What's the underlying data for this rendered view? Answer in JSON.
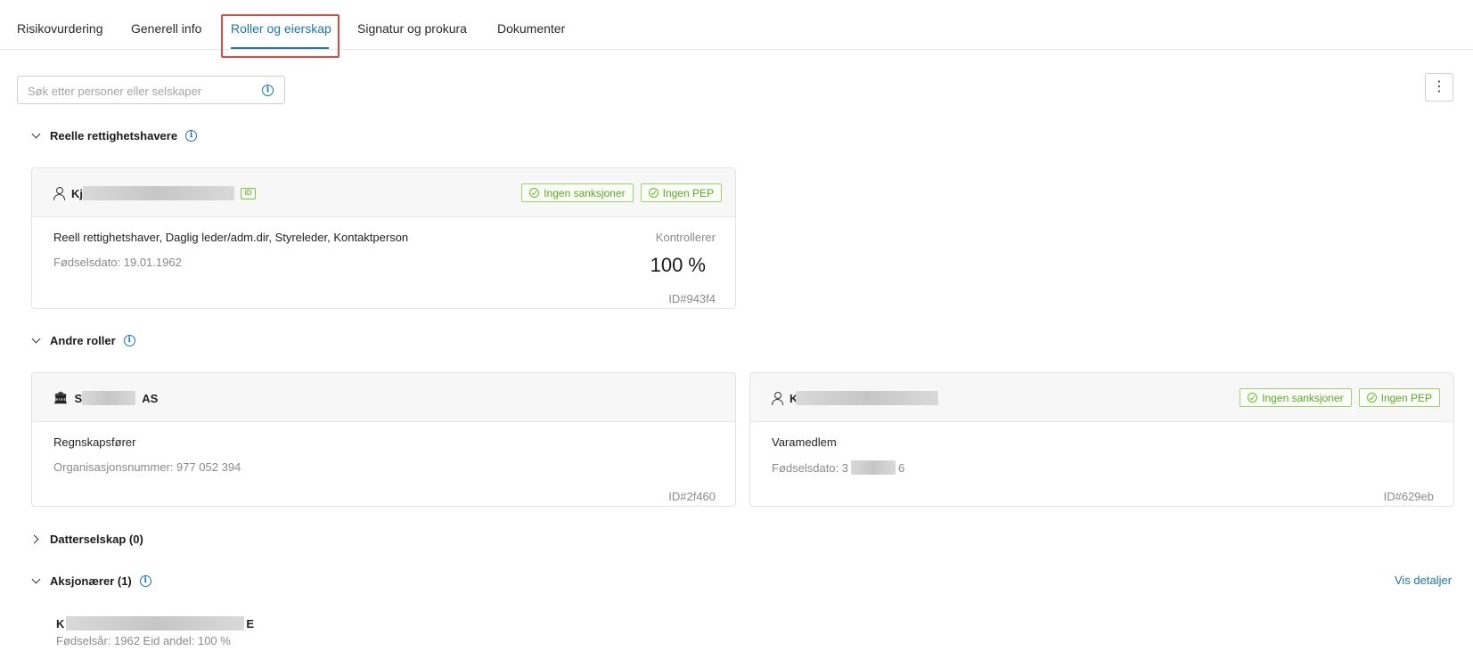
{
  "tabs": [
    {
      "label": "Risikovurdering"
    },
    {
      "label": "Generell info"
    },
    {
      "label": "Roller og eierskap",
      "active": true
    },
    {
      "label": "Signatur og prokura"
    },
    {
      "label": "Dokumenter"
    }
  ],
  "search": {
    "placeholder": "Søk etter personer eller selskaper"
  },
  "menu": {
    "kebab": "⋮"
  },
  "sections": {
    "beneficial_owners": {
      "title": "Reelle rettighetshavere"
    },
    "other_roles": {
      "title": "Andre roller"
    },
    "subsidiaries": {
      "title": "Datterselskap (0)"
    },
    "shareholders": {
      "title": "Aksjonærer (1)",
      "details_link": "Vis detaljer"
    }
  },
  "beneficial_owner_card": {
    "name_prefix": "Kj",
    "badges": [
      "Ingen sanksjoner",
      "Ingen PEP"
    ],
    "roles": "Reell rettighetshaver, Daglig leder/adm.dir, Styreleder, Kontaktperson",
    "birth_date": "Fødselsdato: 19.01.1962",
    "control_label": "Kontrollerer",
    "control_value": "100 %",
    "id": "ID#943f4"
  },
  "other_role_cards": [
    {
      "name_prefix": "S",
      "name_suffix": "AS",
      "role": "Regnskapsfører",
      "meta": "Organisasjonsnummer: 977 052 394",
      "id": "ID#2f460"
    },
    {
      "name_prefix": "K",
      "badges": [
        "Ingen sanksjoner",
        "Ingen PEP"
      ],
      "role": "Varamedlem",
      "meta_prefix": "Fødselsdato: 3",
      "meta_suffix": "6",
      "id": "ID#629eb"
    }
  ],
  "shareholder": {
    "name_prefix": "K",
    "name_suffix": "E",
    "meta": "Fødselsår: 1962  Eid andel: 100 %"
  },
  "colors": {
    "accent": "#1c74b8",
    "badge_green": "#5aa928",
    "highlight_red": "#e04848"
  }
}
